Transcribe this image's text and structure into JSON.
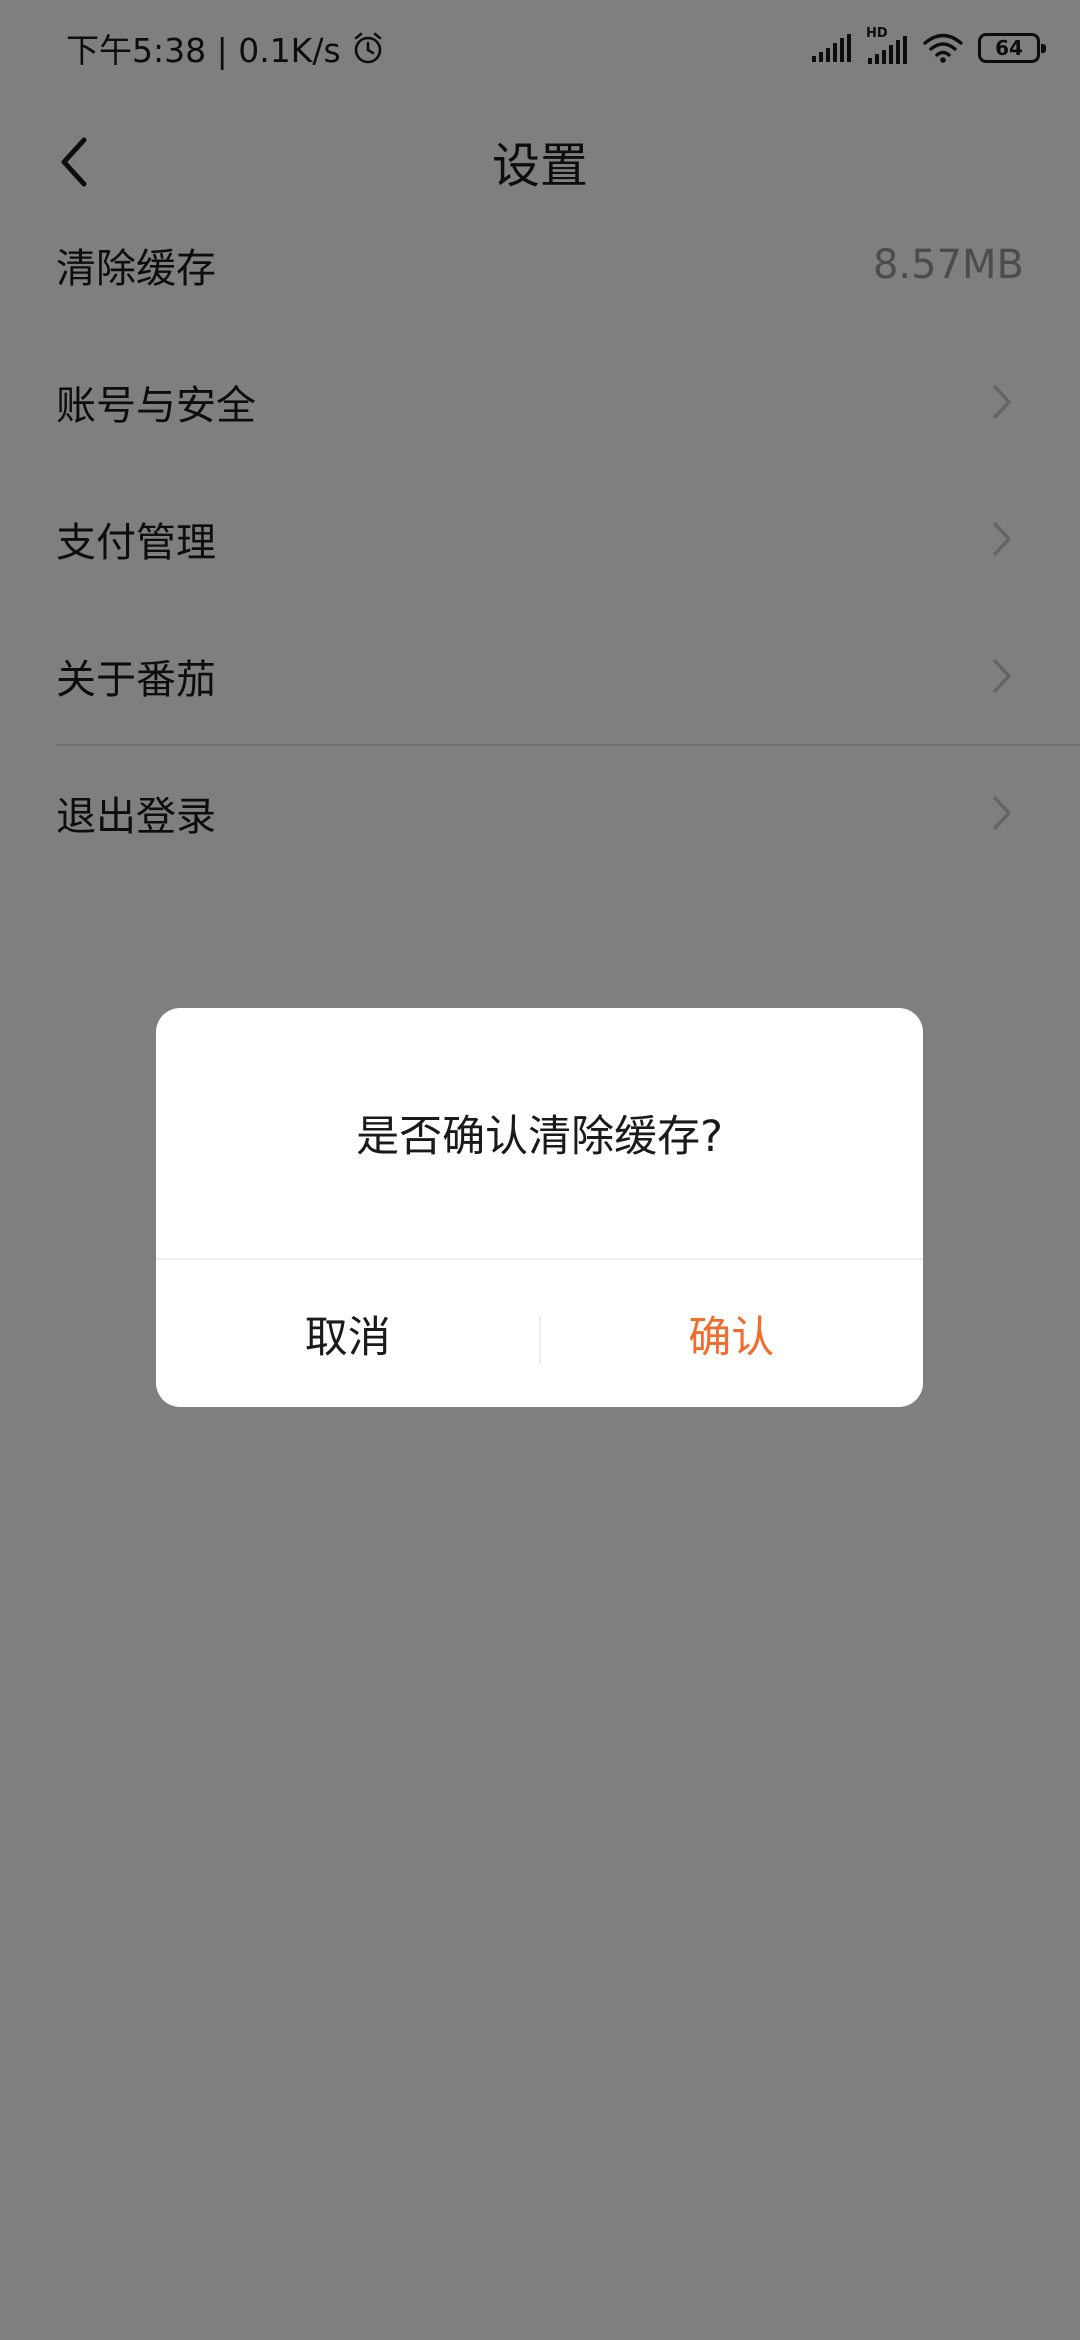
{
  "status_bar": {
    "time_and_speed": "下午5:38 | 0.1K/s",
    "icons": [
      "alarm-icon",
      "signal-icon",
      "hd-signal-icon",
      "wifi-icon",
      "battery-icon"
    ],
    "hd_label": "HD",
    "battery_level": "64"
  },
  "header": {
    "title": "设置",
    "back_icon": "back-arrow-icon"
  },
  "settings": {
    "items": [
      {
        "label": "清除缓存",
        "value": "8.57MB"
      },
      {
        "label": "账号与安全",
        "icon": "chevron-right-icon"
      },
      {
        "label": "支付管理",
        "icon": "chevron-right-icon"
      },
      {
        "label": "关于番茄",
        "icon": "chevron-right-icon"
      },
      {
        "label": "退出登录",
        "icon": "chevron-right-icon"
      }
    ]
  },
  "dialog": {
    "message": "是否确认清除缓存?",
    "cancel_label": "取消",
    "confirm_label": "确认"
  },
  "colors": {
    "accent": "#f36c2b",
    "overlay": "rgba(0,0,0,0.5)",
    "secondary_text": "#999999"
  }
}
